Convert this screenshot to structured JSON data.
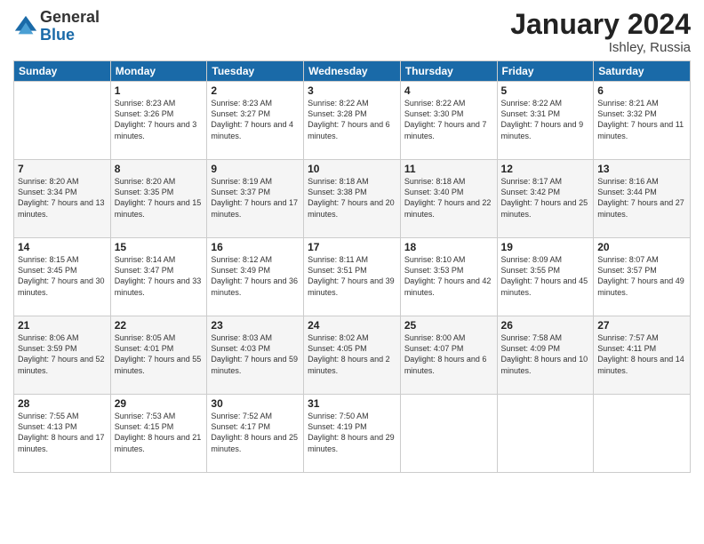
{
  "logo": {
    "general": "General",
    "blue": "Blue"
  },
  "header": {
    "title": "January 2024",
    "location": "Ishley, Russia"
  },
  "weekdays": [
    "Sunday",
    "Monday",
    "Tuesday",
    "Wednesday",
    "Thursday",
    "Friday",
    "Saturday"
  ],
  "weeks": [
    [
      {
        "day": "",
        "sunrise": "",
        "sunset": "",
        "daylight": ""
      },
      {
        "day": "1",
        "sunrise": "Sunrise: 8:23 AM",
        "sunset": "Sunset: 3:26 PM",
        "daylight": "Daylight: 7 hours and 3 minutes."
      },
      {
        "day": "2",
        "sunrise": "Sunrise: 8:23 AM",
        "sunset": "Sunset: 3:27 PM",
        "daylight": "Daylight: 7 hours and 4 minutes."
      },
      {
        "day": "3",
        "sunrise": "Sunrise: 8:22 AM",
        "sunset": "Sunset: 3:28 PM",
        "daylight": "Daylight: 7 hours and 6 minutes."
      },
      {
        "day": "4",
        "sunrise": "Sunrise: 8:22 AM",
        "sunset": "Sunset: 3:30 PM",
        "daylight": "Daylight: 7 hours and 7 minutes."
      },
      {
        "day": "5",
        "sunrise": "Sunrise: 8:22 AM",
        "sunset": "Sunset: 3:31 PM",
        "daylight": "Daylight: 7 hours and 9 minutes."
      },
      {
        "day": "6",
        "sunrise": "Sunrise: 8:21 AM",
        "sunset": "Sunset: 3:32 PM",
        "daylight": "Daylight: 7 hours and 11 minutes."
      }
    ],
    [
      {
        "day": "7",
        "sunrise": "Sunrise: 8:20 AM",
        "sunset": "Sunset: 3:34 PM",
        "daylight": "Daylight: 7 hours and 13 minutes."
      },
      {
        "day": "8",
        "sunrise": "Sunrise: 8:20 AM",
        "sunset": "Sunset: 3:35 PM",
        "daylight": "Daylight: 7 hours and 15 minutes."
      },
      {
        "day": "9",
        "sunrise": "Sunrise: 8:19 AM",
        "sunset": "Sunset: 3:37 PM",
        "daylight": "Daylight: 7 hours and 17 minutes."
      },
      {
        "day": "10",
        "sunrise": "Sunrise: 8:18 AM",
        "sunset": "Sunset: 3:38 PM",
        "daylight": "Daylight: 7 hours and 20 minutes."
      },
      {
        "day": "11",
        "sunrise": "Sunrise: 8:18 AM",
        "sunset": "Sunset: 3:40 PM",
        "daylight": "Daylight: 7 hours and 22 minutes."
      },
      {
        "day": "12",
        "sunrise": "Sunrise: 8:17 AM",
        "sunset": "Sunset: 3:42 PM",
        "daylight": "Daylight: 7 hours and 25 minutes."
      },
      {
        "day": "13",
        "sunrise": "Sunrise: 8:16 AM",
        "sunset": "Sunset: 3:44 PM",
        "daylight": "Daylight: 7 hours and 27 minutes."
      }
    ],
    [
      {
        "day": "14",
        "sunrise": "Sunrise: 8:15 AM",
        "sunset": "Sunset: 3:45 PM",
        "daylight": "Daylight: 7 hours and 30 minutes."
      },
      {
        "day": "15",
        "sunrise": "Sunrise: 8:14 AM",
        "sunset": "Sunset: 3:47 PM",
        "daylight": "Daylight: 7 hours and 33 minutes."
      },
      {
        "day": "16",
        "sunrise": "Sunrise: 8:12 AM",
        "sunset": "Sunset: 3:49 PM",
        "daylight": "Daylight: 7 hours and 36 minutes."
      },
      {
        "day": "17",
        "sunrise": "Sunrise: 8:11 AM",
        "sunset": "Sunset: 3:51 PM",
        "daylight": "Daylight: 7 hours and 39 minutes."
      },
      {
        "day": "18",
        "sunrise": "Sunrise: 8:10 AM",
        "sunset": "Sunset: 3:53 PM",
        "daylight": "Daylight: 7 hours and 42 minutes."
      },
      {
        "day": "19",
        "sunrise": "Sunrise: 8:09 AM",
        "sunset": "Sunset: 3:55 PM",
        "daylight": "Daylight: 7 hours and 45 minutes."
      },
      {
        "day": "20",
        "sunrise": "Sunrise: 8:07 AM",
        "sunset": "Sunset: 3:57 PM",
        "daylight": "Daylight: 7 hours and 49 minutes."
      }
    ],
    [
      {
        "day": "21",
        "sunrise": "Sunrise: 8:06 AM",
        "sunset": "Sunset: 3:59 PM",
        "daylight": "Daylight: 7 hours and 52 minutes."
      },
      {
        "day": "22",
        "sunrise": "Sunrise: 8:05 AM",
        "sunset": "Sunset: 4:01 PM",
        "daylight": "Daylight: 7 hours and 55 minutes."
      },
      {
        "day": "23",
        "sunrise": "Sunrise: 8:03 AM",
        "sunset": "Sunset: 4:03 PM",
        "daylight": "Daylight: 7 hours and 59 minutes."
      },
      {
        "day": "24",
        "sunrise": "Sunrise: 8:02 AM",
        "sunset": "Sunset: 4:05 PM",
        "daylight": "Daylight: 8 hours and 2 minutes."
      },
      {
        "day": "25",
        "sunrise": "Sunrise: 8:00 AM",
        "sunset": "Sunset: 4:07 PM",
        "daylight": "Daylight: 8 hours and 6 minutes."
      },
      {
        "day": "26",
        "sunrise": "Sunrise: 7:58 AM",
        "sunset": "Sunset: 4:09 PM",
        "daylight": "Daylight: 8 hours and 10 minutes."
      },
      {
        "day": "27",
        "sunrise": "Sunrise: 7:57 AM",
        "sunset": "Sunset: 4:11 PM",
        "daylight": "Daylight: 8 hours and 14 minutes."
      }
    ],
    [
      {
        "day": "28",
        "sunrise": "Sunrise: 7:55 AM",
        "sunset": "Sunset: 4:13 PM",
        "daylight": "Daylight: 8 hours and 17 minutes."
      },
      {
        "day": "29",
        "sunrise": "Sunrise: 7:53 AM",
        "sunset": "Sunset: 4:15 PM",
        "daylight": "Daylight: 8 hours and 21 minutes."
      },
      {
        "day": "30",
        "sunrise": "Sunrise: 7:52 AM",
        "sunset": "Sunset: 4:17 PM",
        "daylight": "Daylight: 8 hours and 25 minutes."
      },
      {
        "day": "31",
        "sunrise": "Sunrise: 7:50 AM",
        "sunset": "Sunset: 4:19 PM",
        "daylight": "Daylight: 8 hours and 29 minutes."
      },
      {
        "day": "",
        "sunrise": "",
        "sunset": "",
        "daylight": ""
      },
      {
        "day": "",
        "sunrise": "",
        "sunset": "",
        "daylight": ""
      },
      {
        "day": "",
        "sunrise": "",
        "sunset": "",
        "daylight": ""
      }
    ]
  ]
}
